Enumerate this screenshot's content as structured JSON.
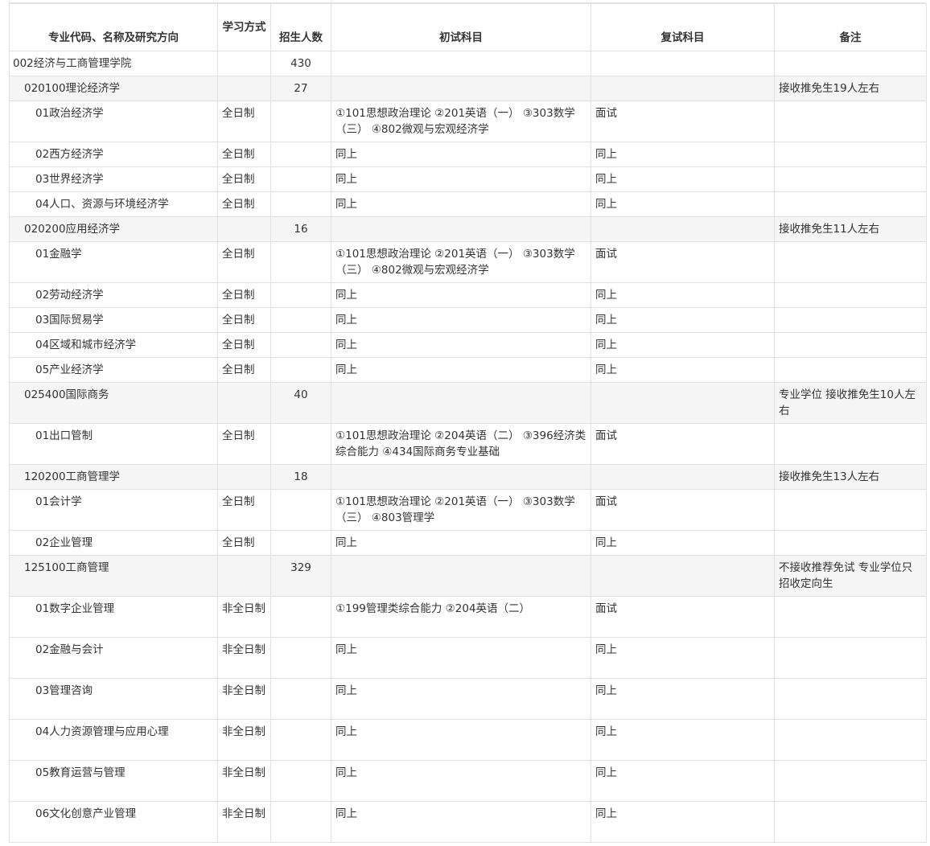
{
  "headers": {
    "major": "专业代码、名称及研究方向",
    "mode": "学习方式",
    "quota": "招生人数",
    "initial": "初试科目",
    "retest": "复试科目",
    "note": "备注"
  },
  "rows": [
    {
      "level": 0,
      "shade": false,
      "major": "002经济与工商管理学院",
      "mode": "",
      "quota": "430",
      "initial": "",
      "retest": "",
      "note": ""
    },
    {
      "level": 1,
      "shade": true,
      "major": "020100理论经济学",
      "mode": "",
      "quota": "27",
      "initial": "",
      "retest": "",
      "note": "接收推免生19人左右"
    },
    {
      "level": 2,
      "shade": false,
      "major": "01政治经济学",
      "mode": "全日制",
      "quota": "",
      "initial": "①101思想政治理论 ②201英语（一） ③303数学（三） ④802微观与宏观经济学",
      "retest": "面试",
      "note": ""
    },
    {
      "level": 2,
      "shade": false,
      "major": "02西方经济学",
      "mode": "全日制",
      "quota": "",
      "initial": "同上",
      "retest": "同上",
      "note": ""
    },
    {
      "level": 2,
      "shade": false,
      "major": "03世界经济学",
      "mode": "全日制",
      "quota": "",
      "initial": "同上",
      "retest": "同上",
      "note": ""
    },
    {
      "level": 2,
      "shade": false,
      "major": "04人口、资源与环境经济学",
      "mode": "全日制",
      "quota": "",
      "initial": "同上",
      "retest": "同上",
      "note": ""
    },
    {
      "level": 1,
      "shade": true,
      "major": "020200应用经济学",
      "mode": "",
      "quota": "16",
      "initial": "",
      "retest": "",
      "note": "接收推免生11人左右"
    },
    {
      "level": 2,
      "shade": false,
      "major": "01金融学",
      "mode": "全日制",
      "quota": "",
      "initial": "①101思想政治理论 ②201英语（一） ③303数学（三） ④802微观与宏观经济学",
      "retest": "面试",
      "note": ""
    },
    {
      "level": 2,
      "shade": false,
      "major": "02劳动经济学",
      "mode": "全日制",
      "quota": "",
      "initial": "同上",
      "retest": "同上",
      "note": ""
    },
    {
      "level": 2,
      "shade": false,
      "major": "03国际贸易学",
      "mode": "全日制",
      "quota": "",
      "initial": "同上",
      "retest": "同上",
      "note": ""
    },
    {
      "level": 2,
      "shade": false,
      "major": "04区域和城市经济学",
      "mode": "全日制",
      "quota": "",
      "initial": "同上",
      "retest": "同上",
      "note": ""
    },
    {
      "level": 2,
      "shade": false,
      "major": "05产业经济学",
      "mode": "全日制",
      "quota": "",
      "initial": "同上",
      "retest": "同上",
      "note": ""
    },
    {
      "level": 1,
      "shade": true,
      "major": "025400国际商务",
      "mode": "",
      "quota": "40",
      "initial": "",
      "retest": "",
      "note": "专业学位 接收推免生10人左右"
    },
    {
      "level": 2,
      "shade": false,
      "major": "01出口管制",
      "mode": "全日制",
      "quota": "",
      "initial": "①101思想政治理论 ②204英语（二） ③396经济类综合能力 ④434国际商务专业基础",
      "retest": "面试",
      "note": ""
    },
    {
      "level": 1,
      "shade": true,
      "major": "120200工商管理学",
      "mode": "",
      "quota": "18",
      "initial": "",
      "retest": "",
      "note": "接收推免生13人左右"
    },
    {
      "level": 2,
      "shade": false,
      "major": "01会计学",
      "mode": "全日制",
      "quota": "",
      "initial": "①101思想政治理论 ②201英语（一） ③303数学（三） ④803管理学",
      "retest": "面试",
      "note": ""
    },
    {
      "level": 2,
      "shade": false,
      "major": "02企业管理",
      "mode": "全日制",
      "quota": "",
      "initial": "同上",
      "retest": "同上",
      "note": ""
    },
    {
      "level": 1,
      "shade": true,
      "major": "125100工商管理",
      "mode": "",
      "quota": "329",
      "initial": "",
      "retest": "",
      "note": "不接收推荐免试 专业学位只招收定向生"
    },
    {
      "level": 2,
      "shade": false,
      "major": "01数字企业管理",
      "mode": "非全日制",
      "quota": "",
      "initial": "①199管理类综合能力 ②204英语（二）",
      "retest": "面试",
      "note": ""
    },
    {
      "level": 2,
      "shade": false,
      "major": "02金融与会计",
      "mode": "非全日制",
      "quota": "",
      "initial": "同上",
      "retest": "同上",
      "note": ""
    },
    {
      "level": 2,
      "shade": false,
      "major": "03管理咨询",
      "mode": "非全日制",
      "quota": "",
      "initial": "同上",
      "retest": "同上",
      "note": ""
    },
    {
      "level": 2,
      "shade": false,
      "major": "04人力资源管理与应用心理",
      "mode": "非全日制",
      "quota": "",
      "initial": "同上",
      "retest": "同上",
      "note": ""
    },
    {
      "level": 2,
      "shade": false,
      "major": "05教育运营与管理",
      "mode": "非全日制",
      "quota": "",
      "initial": "同上",
      "retest": "同上",
      "note": ""
    },
    {
      "level": 2,
      "shade": false,
      "major": "06文化创意产业管理",
      "mode": "非全日制",
      "quota": "",
      "initial": "同上",
      "retest": "同上",
      "note": ""
    }
  ]
}
